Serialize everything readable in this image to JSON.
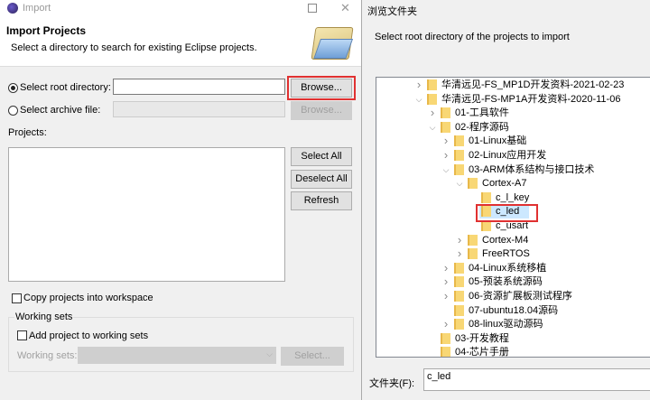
{
  "import_dialog": {
    "title": "Import",
    "header_title": "Import Projects",
    "header_desc": "Select a directory to search for existing Eclipse projects.",
    "root_dir_label": "Select root directory:",
    "root_dir_value": "",
    "archive_label": "Select archive file:",
    "browse_label": "Browse...",
    "browse_archive_label": "Browse...",
    "projects_label": "Projects:",
    "select_all": "Select All",
    "deselect_all": "Deselect All",
    "refresh": "Refresh",
    "copy_label": "Copy projects into workspace",
    "working_sets_group": "Working sets",
    "add_ws_label": "Add project to working sets",
    "ws_label": "Working sets:",
    "select_btn": "Select..."
  },
  "browse_dialog": {
    "title": "浏览文件夹",
    "instruction": "Select root directory of the projects to import",
    "folder_label": "文件夹(F):",
    "folder_value": "c_led",
    "tree": [
      {
        "label": "华清远见-FS_MP1D开发资料-2021-02-23",
        "level": 0,
        "state": "closed"
      },
      {
        "label": "华清远见-FS-MP1A开发资料-2020-11-06",
        "level": 0,
        "state": "open"
      },
      {
        "label": "01-工具软件",
        "level": 1,
        "state": "closed"
      },
      {
        "label": "02-程序源码",
        "level": 1,
        "state": "open"
      },
      {
        "label": "01-Linux基础",
        "level": 2,
        "state": "closed"
      },
      {
        "label": "02-Linux应用开发",
        "level": 2,
        "state": "closed"
      },
      {
        "label": "03-ARM体系结构与接口技术",
        "level": 2,
        "state": "open"
      },
      {
        "label": "Cortex-A7",
        "level": 3,
        "state": "open"
      },
      {
        "label": "c_l_key",
        "level": 4,
        "state": "none"
      },
      {
        "label": "c_led",
        "level": 4,
        "state": "none",
        "selected": true
      },
      {
        "label": "c_usart",
        "level": 4,
        "state": "none"
      },
      {
        "label": "Cortex-M4",
        "level": 3,
        "state": "closed"
      },
      {
        "label": "FreeRTOS",
        "level": 3,
        "state": "closed"
      },
      {
        "label": "04-Linux系统移植",
        "level": 2,
        "state": "closed"
      },
      {
        "label": "05-预装系统源码",
        "level": 2,
        "state": "closed"
      },
      {
        "label": "06-资源扩展板测试程序",
        "level": 2,
        "state": "closed"
      },
      {
        "label": "07-ubuntu18.04源码",
        "level": 2,
        "state": "none"
      },
      {
        "label": "08-linux驱动源码",
        "level": 2,
        "state": "closed"
      },
      {
        "label": "03-开发教程",
        "level": 1,
        "state": "none"
      },
      {
        "label": "04-芯片手册",
        "level": 1,
        "state": "none"
      }
    ]
  },
  "colors": {
    "highlight": "#e03131",
    "selection": "#cce8ff",
    "folder": "#f8d775"
  }
}
